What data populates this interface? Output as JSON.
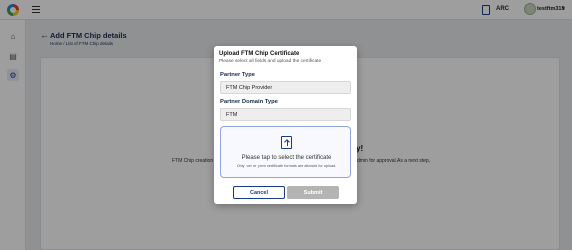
{
  "header": {
    "title": "Add FTM Chip details",
    "breadcrumb": "Home / List of FTM Chip details"
  },
  "topbar": {
    "language": "ARC",
    "user_name": "testftm315"
  },
  "sidebar": {
    "icons": [
      "home-icon",
      "document-icon",
      "settings-icon"
    ],
    "active": "settings-icon"
  },
  "content": {
    "heading_fragment": "y!",
    "text_left": "FTM Chip creation",
    "text_right": "dmin for approval.As a next step,"
  },
  "modal": {
    "title": "Upload FTM Chip Certificate",
    "subtitle": "Please select all fields and upload the certificate",
    "partner_type_label": "Partner Type",
    "partner_type_value": "FTM Chip Provider",
    "partner_domain_label": "Partner Domain Type",
    "partner_domain_value": "FTM",
    "upload_text": "Please tap to select the certificate",
    "upload_hint": "Only .cer or .pem certificate formats are allowed for upload.",
    "cancel_label": "Cancel",
    "submit_label": "Submit"
  },
  "colors": {
    "primary": "#1a3a8f",
    "overlay": "#000000",
    "submit_disabled": "#b4b4b4"
  }
}
